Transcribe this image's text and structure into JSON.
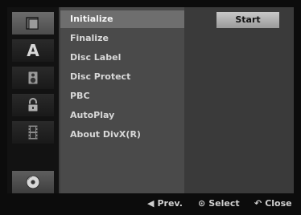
{
  "sidebar": {
    "items": [
      {
        "icon": "disc-folder-icon"
      },
      {
        "icon": "language-a-icon",
        "glyph": "A"
      },
      {
        "icon": "speaker-icon"
      },
      {
        "icon": "lock-icon"
      },
      {
        "icon": "film-strip-icon"
      },
      {
        "icon": "disc-icon"
      }
    ]
  },
  "menu": {
    "items": [
      {
        "label": "Initialize"
      },
      {
        "label": "Finalize"
      },
      {
        "label": "Disc Label"
      },
      {
        "label": "Disc Protect"
      },
      {
        "label": "PBC"
      },
      {
        "label": "AutoPlay"
      },
      {
        "label": "About DivX(R)"
      }
    ],
    "selected": "Initialize"
  },
  "action": {
    "start_label": "Start"
  },
  "footer": {
    "prev_label": "Prev.",
    "select_label": "Select",
    "close_label": "Close"
  }
}
